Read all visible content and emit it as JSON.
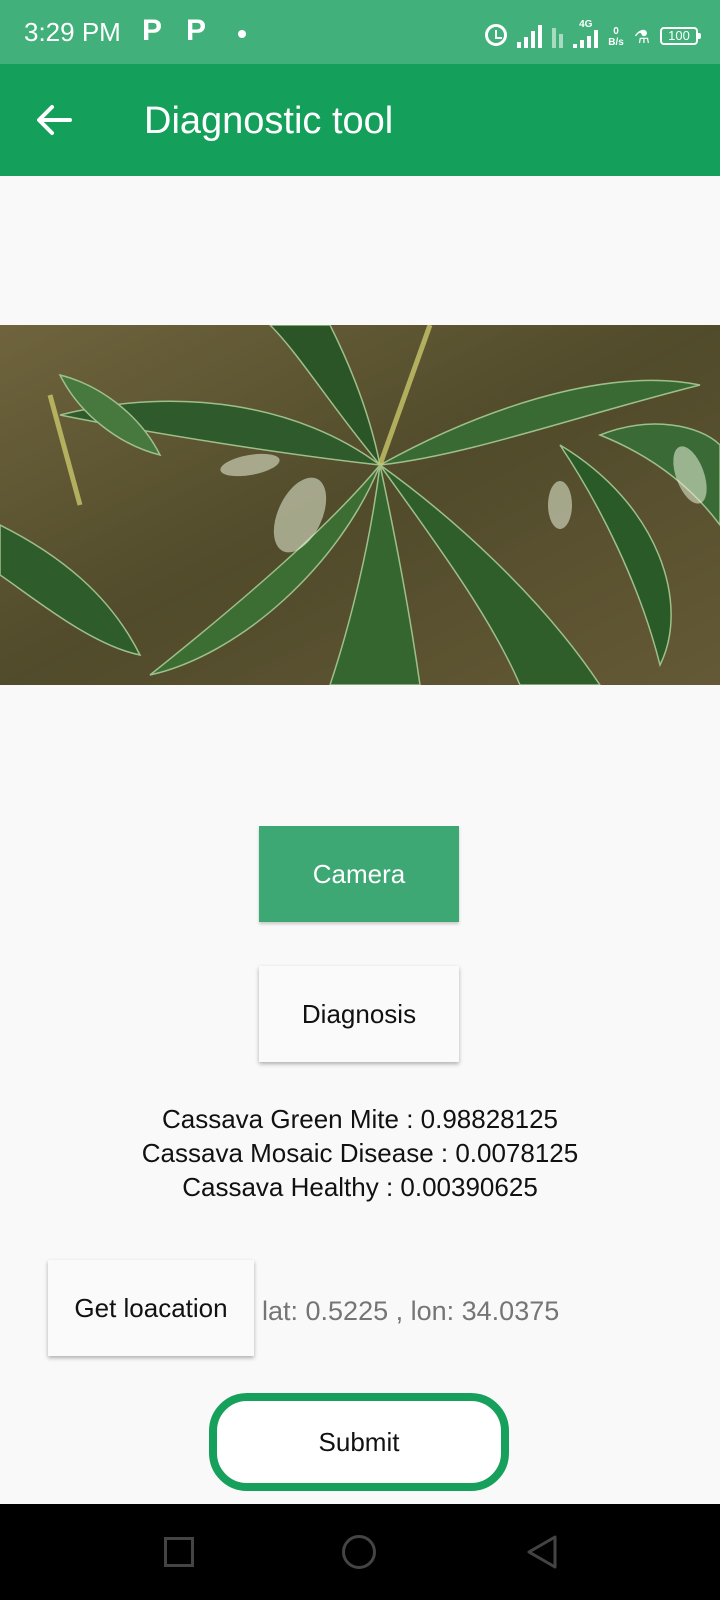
{
  "status_bar": {
    "time": "3:29 PM",
    "notif_1": "P",
    "notif_2": "P",
    "network": "4G",
    "data_rate_value": "0",
    "data_rate_unit": "B/s",
    "battery": "100"
  },
  "app_bar": {
    "title": "Diagnostic tool"
  },
  "buttons": {
    "camera": "Camera",
    "diagnosis": "Diagnosis",
    "get_location": "Get loacation",
    "submit": "Submit"
  },
  "results": [
    "Cassava Green Mite : 0.98828125",
    "Cassava Mosaic Disease : 0.0078125",
    "Cassava Healthy : 0.00390625"
  ],
  "location_text": "lat: 0.5225 , lon: 34.0375",
  "colors": {
    "status_bar": "#41b07a",
    "app_bar": "#14a05a",
    "camera_button": "#3ea874",
    "submit_border": "#17a05c"
  }
}
